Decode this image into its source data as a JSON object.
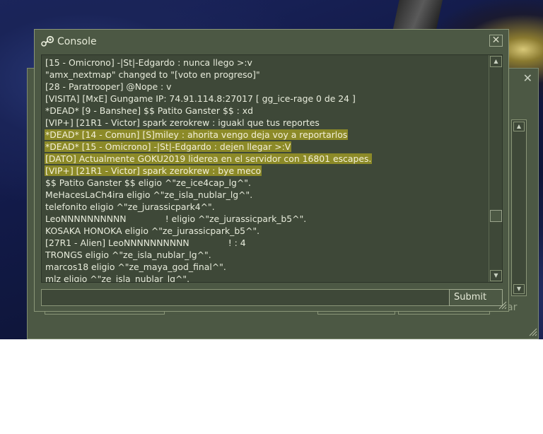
{
  "console": {
    "title": "Console",
    "close_label": "✕",
    "submit_label": "Submit",
    "input_value": "",
    "highlight_color": "#8c8a28",
    "lines": [
      {
        "text": "[15 - Omicrono] -|St|-Edgardo : nunca llego >:v",
        "highlight": false
      },
      {
        "text": "\"amx_nextmap\" changed to \"[voto en progreso]\"",
        "highlight": false
      },
      {
        "text": "[28 - Paratrooper] @Nope : v",
        "highlight": false
      },
      {
        "text": "[VISITA] [MxE] Gungame IP: 74.91.114.8:27017 [ gg_ice-rage 0 de 24 ]",
        "highlight": false
      },
      {
        "text": "*DEAD* [9 - Banshee] $$ Patito Ganster $$ : xd",
        "highlight": false
      },
      {
        "text": "[VIP+] [21R1 - Victor] spark zerokrew : iguakl que tus reportes",
        "highlight": false
      },
      {
        "text": "*DEAD* [14 - Comun] [S]miley : ahorita vengo deja voy a reportarlos",
        "highlight": true
      },
      {
        "text": "*DEAD* [15 - Omicrono] -|St|-Edgardo : dejen llegar >:V",
        "highlight": true
      },
      {
        "text": "[DATO] Actualmente GOKU2019 liderea en el servidor con 16801 escapes.",
        "highlight": true
      },
      {
        "text": "[VIP+] [21R1 - Victor] spark zerokrew : bye meco",
        "highlight": true
      },
      {
        "text": "$$ Patito Ganster $$ eligio ^\"ze_ice4cap_lg^\".",
        "highlight": false
      },
      {
        "text": "MeHacesLaCh4ira eligio ^\"ze_isla_nublar_lg^\".",
        "highlight": false
      },
      {
        "text": "telefonito eligio ^\"ze_jurassicpark4^\".",
        "highlight": false
      },
      {
        "text": "LeoNNNNNNNNNN              ! eligio ^\"ze_jurassicpark_b5^\".",
        "highlight": false
      },
      {
        "text": "KOSAKA HONOKA eligio ^\"ze_jurassicpark_b5^\".",
        "highlight": false
      },
      {
        "text": "[27R1 - Alien] LeoNNNNNNNNNN              ! : 4",
        "highlight": false
      },
      {
        "text": "TRONGS eligio ^\"ze_isla_nublar_lg^\".",
        "highlight": false
      },
      {
        "text": "marcos18 eligio ^\"ze_maya_god_final^\".",
        "highlight": false
      },
      {
        "text": "mlz eligio ^\"ze_isla_nublar_lg^\".",
        "highlight": false
      }
    ]
  },
  "back_window": {
    "close_label": "✕",
    "button_label": "ar"
  },
  "icons": {
    "console_icon": "steam-logo-icon",
    "scroll_up": "arrow-up-icon",
    "scroll_down": "arrow-down-icon"
  }
}
